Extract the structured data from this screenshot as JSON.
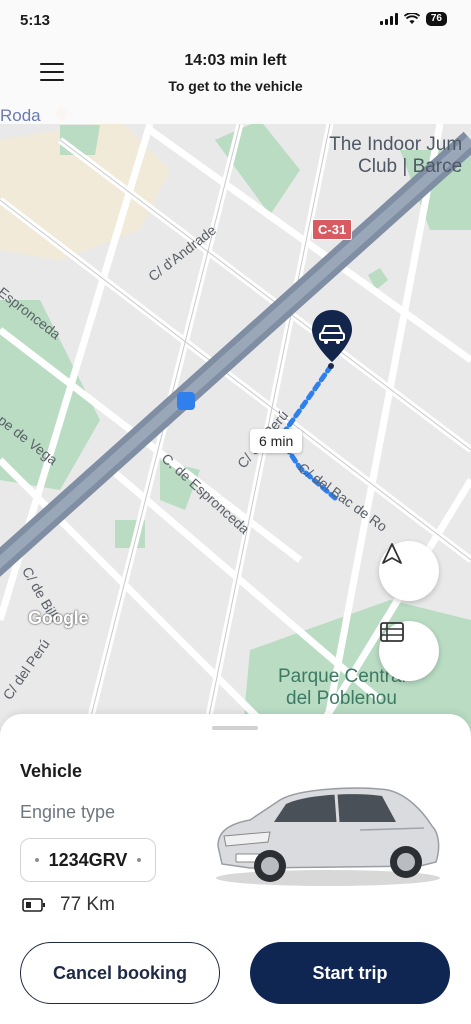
{
  "status_bar": {
    "time": "5:13",
    "battery": "76"
  },
  "header": {
    "title": "14:03 min left",
    "subtitle": "To get to the vehicle"
  },
  "map": {
    "highway_badge": "C-31",
    "poi_top": [
      "The Indoor Jum",
      "Club | Barce"
    ],
    "poi_park": [
      "Parque Central",
      "del Poblenou"
    ],
    "roda_label": "Roda",
    "google_logo": "Google",
    "eta": "6 min",
    "streets": {
      "andrade": "C/ d'Andrade",
      "espronceda_left": "Espronceda",
      "espronceda_mid": "C. de Espronceda",
      "vega": "pe de Vega",
      "bilbao": "C/ de Bilb",
      "peru_left": "C/ del Perú",
      "peru_center": "C/ del Perú",
      "bac": "C/ del Bac de Ro"
    }
  },
  "sheet": {
    "title": "Vehicle",
    "engine_label": "Engine type",
    "plate": "1234GRV",
    "range": "77 Km",
    "cancel_label": "Cancel booking",
    "start_label": "Start trip"
  }
}
